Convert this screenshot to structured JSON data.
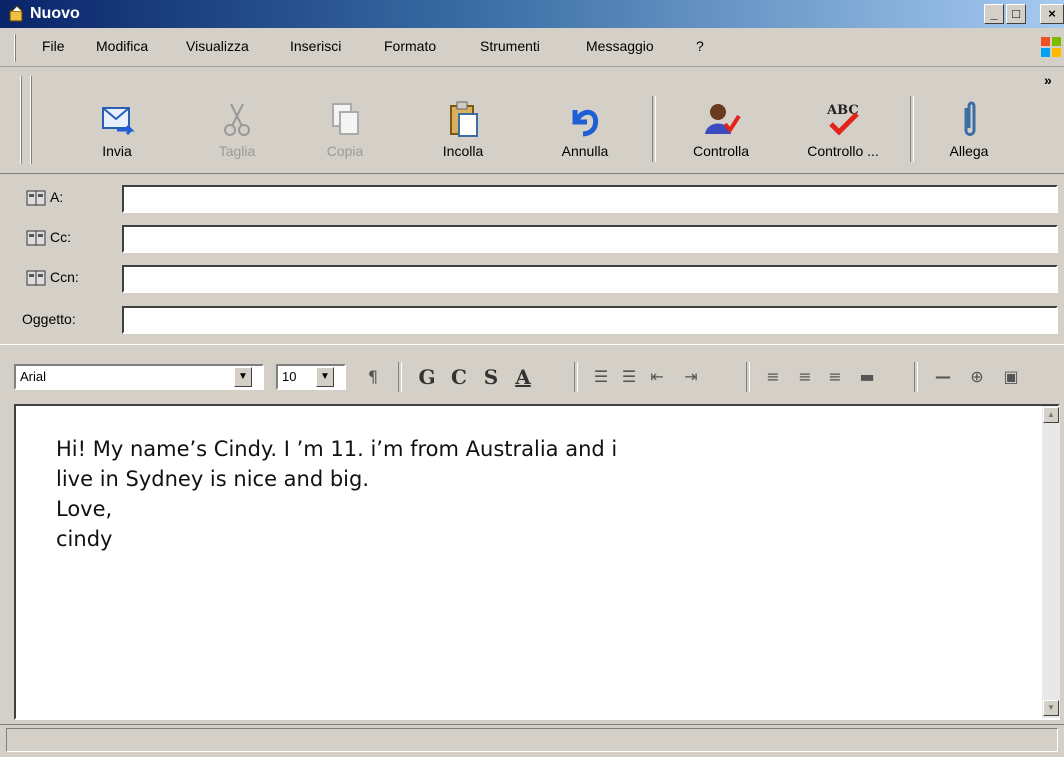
{
  "window": {
    "title": "Nuovo",
    "controls": [
      "_",
      "□",
      "×"
    ]
  },
  "menu": {
    "items": [
      "File",
      "Modifica",
      "Visualizza",
      "Inserisci",
      "Formato",
      "Strumenti",
      "Messaggio",
      "?"
    ],
    "chevron": "»"
  },
  "toolbar": {
    "buttons": [
      {
        "label": "Invia",
        "icon": "send-icon",
        "enabled": true
      },
      {
        "label": "Taglia",
        "icon": "scissors-icon",
        "enabled": false
      },
      {
        "label": "Copia",
        "icon": "copy-icon",
        "enabled": false
      },
      {
        "label": "Incolla",
        "icon": "clipboard-icon",
        "enabled": true
      },
      {
        "label": "Annulla",
        "icon": "undo-icon",
        "enabled": true
      },
      {
        "label": "Controlla",
        "icon": "check-names-icon",
        "enabled": true
      },
      {
        "label": "Controllo ...",
        "icon": "spellcheck-icon",
        "enabled": true
      },
      {
        "label": "Allega",
        "icon": "paperclip-icon",
        "enabled": true
      }
    ]
  },
  "header": {
    "to_label": "A:",
    "cc_label": "Cc:",
    "bcc_label": "Ccn:",
    "subject_label": "Oggetto:",
    "to_value": "",
    "cc_value": "",
    "bcc_value": "",
    "subject_value": ""
  },
  "format": {
    "font": "Arial",
    "size": "10",
    "bold": "G",
    "italic": "C",
    "underline": "S",
    "font_color": "A"
  },
  "message": {
    "line1": "Hi! My name’s Cindy. I ’m 11. i’m from Australia and i",
    "line2": "live in Sydney is nice and big.",
    "line3": "Love,",
    "line4": "cindy"
  },
  "colors": {
    "titlebar_start": "#0a246a",
    "titlebar_end": "#a6caf0",
    "chrome": "#d4d0c8",
    "undo_blue": "#1e5fd6",
    "check_red": "#e0241b"
  }
}
